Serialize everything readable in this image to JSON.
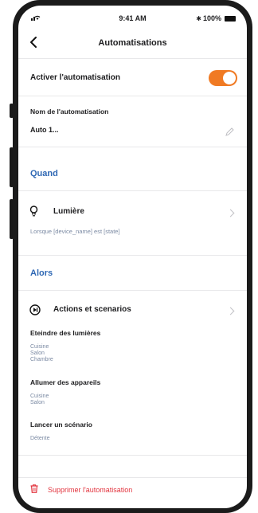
{
  "status": {
    "time": "9:41 AM",
    "battery": "100%"
  },
  "nav": {
    "back_icon": "chevron-left-icon",
    "title": "Automatisations"
  },
  "activate": {
    "label": "Activer l'automatisation",
    "enabled": true,
    "accent": "#f07a23"
  },
  "name_field": {
    "label": "Nom de l'automatisation",
    "value": "Auto 1..."
  },
  "when": {
    "header": "Quand",
    "trigger": {
      "icon": "lightbulb-icon",
      "title": "Lumière",
      "description": "Lorsque [device_name] est [state]"
    }
  },
  "then": {
    "header": "Alors",
    "action": {
      "icon": "play-circle-icon",
      "title": "Actions et scenarios"
    },
    "groups": [
      {
        "title": "Eteindre des lumières",
        "items": [
          "Cuisine",
          "Salon",
          "Chambre"
        ]
      },
      {
        "title": "Allumer des appareils",
        "items": [
          "Cuisine",
          "Salon"
        ]
      },
      {
        "title": "Lancer un scénario",
        "items": [
          "Détente"
        ]
      }
    ]
  },
  "delete": {
    "label": "Supprimer l'automatisation",
    "icon": "trash-icon",
    "color": "#e2343e"
  },
  "colors": {
    "section_header": "#2f68b4",
    "muted": "#7b8aa3"
  }
}
